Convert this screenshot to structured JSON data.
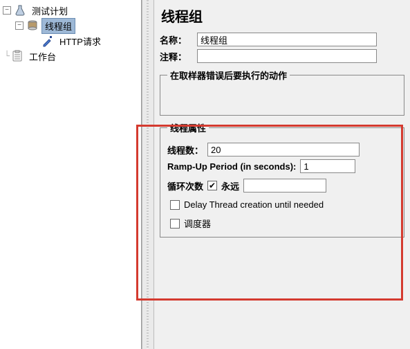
{
  "tree": {
    "root": {
      "label": "测试计划"
    },
    "threadGroup": {
      "label": "线程组"
    },
    "httpRequest": {
      "label": "HTTP请求"
    },
    "workbench": {
      "label": "工作台"
    },
    "toggleMinus": "−"
  },
  "panel": {
    "title": "线程组",
    "nameLabel": "名称：",
    "nameValue": "线程组",
    "commentLabel": "注释：",
    "commentValue": ""
  },
  "errorAction": {
    "legend": "在取样器错误后要执行的动作"
  },
  "threadProps": {
    "legend": "线程属性",
    "threadsLabel": "线程数：",
    "threadsValue": "20",
    "rampLabel": "Ramp-Up Period (in seconds):",
    "rampValue": "1",
    "loopLabel": "循环次数",
    "foreverLabel": "永远",
    "foreverChecked": "✔",
    "foreverValue": "",
    "delayLabel": "Delay Thread creation until needed",
    "schedulerLabel": "调度器"
  }
}
